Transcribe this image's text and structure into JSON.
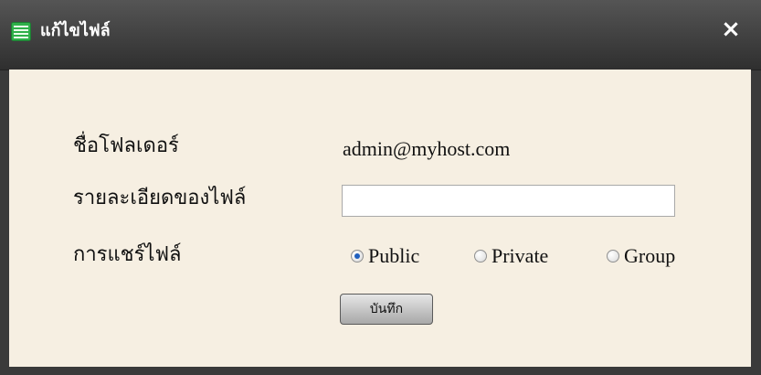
{
  "window": {
    "title": "แก้ไขไฟล์",
    "close_label": "×"
  },
  "form": {
    "folder_name_label": "ชื่อโฟลเดอร์",
    "folder_name_value": "admin@myhost.com",
    "file_description_label": "รายละเอียดของไฟล์",
    "file_description_value": "",
    "file_description_placeholder": "",
    "file_sharing_label": "การแชร์ไฟล์",
    "sharing_options": [
      {
        "label": "Public",
        "checked": true
      },
      {
        "label": "Private",
        "checked": false
      },
      {
        "label": "Group",
        "checked": false
      }
    ],
    "save_label": "บันทึก"
  },
  "colors": {
    "titlebar": "#3a3a3a",
    "content_background": "#f6efe2",
    "icon_green": "#2fb04a"
  }
}
